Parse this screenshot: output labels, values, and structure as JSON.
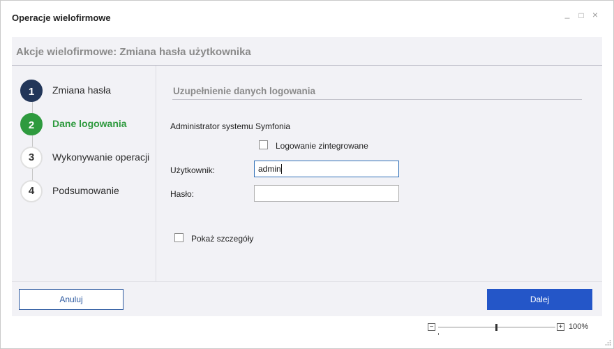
{
  "window": {
    "title": "Operacje wielofirmowe",
    "minimize_glyph": "_",
    "maximize_glyph": "□",
    "close_glyph": "×"
  },
  "header": {
    "title": "Akcje wielofirmowe: Zmiana hasła użytkownika"
  },
  "steps": [
    {
      "number": "1",
      "label": "Zmiana hasła",
      "state": "done"
    },
    {
      "number": "2",
      "label": "Dane logowania",
      "state": "active"
    },
    {
      "number": "3",
      "label": "Wykonywanie operacji",
      "state": "pending"
    },
    {
      "number": "4",
      "label": "Podsumowanie",
      "state": "pending"
    }
  ],
  "form": {
    "section_title": "Uzupełnienie danych logowania",
    "admin_label": "Administrator systemu Symfonia",
    "integrated_login_label": "Logowanie zintegrowane",
    "integrated_login_checked": false,
    "user_label": "Użytkownik:",
    "user_value": "admin",
    "password_label": "Hasło:",
    "password_value": "",
    "show_details_label": "Pokaż szczegóły",
    "show_details_checked": false
  },
  "footer": {
    "cancel_label": "Anuluj",
    "next_label": "Dalej"
  },
  "zoom": {
    "minus_glyph": "−",
    "plus_glyph": "+",
    "level": "100%"
  },
  "colors": {
    "step_done": "#223659",
    "step_active": "#2e9a3e",
    "primary_button": "#2456c8",
    "panel_background": "#f2f2f6"
  }
}
